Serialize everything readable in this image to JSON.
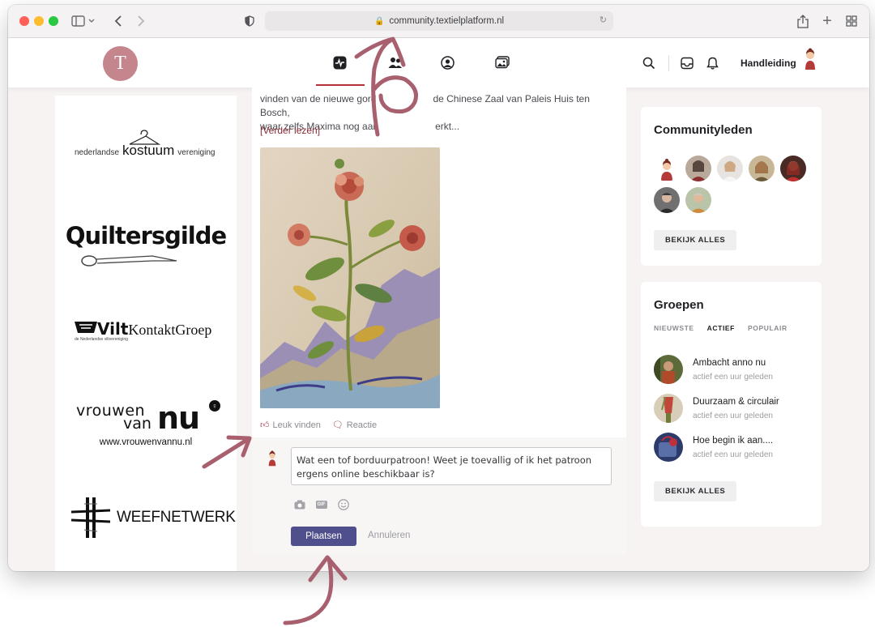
{
  "browser": {
    "url": "community.textielplatform.nl"
  },
  "header": {
    "logo_letter": "T",
    "handleiding_label": "Handleiding",
    "nav_icons": [
      "activity-icon",
      "groups-icon",
      "profile-icon",
      "photos-icon"
    ]
  },
  "sponsors": [
    {
      "name": "nederlandse kostuum vereniging",
      "line1": "nederlandse",
      "line2": "kostuum",
      "line3": "vereniging"
    },
    {
      "name": "Quiltersgilde",
      "text": "Quiltersgilde"
    },
    {
      "name": "Vilt KontaktGroep",
      "text1": "Vilt",
      "text2": "KontaktGroep",
      "sub": "de Nederlandse viltvereniging"
    },
    {
      "name": "vrouwen van nu",
      "text1": "vrouwen",
      "text2": "van",
      "text3": "nu",
      "url": "www.vrouwenvannu.nl"
    },
    {
      "name": "WEEFNETWERK",
      "text": "WEEFNETWERK"
    }
  ],
  "post": {
    "text_line1": "vinden van de nieuwe gord",
    "text_line1b": "de Chinese Zaal van Paleis Huis ten Bosch,",
    "text_line2": "waar zelfs Maxima nog aan",
    "text_line2b": "erkt...",
    "read_more": "[Verder lezen]",
    "like_label": "Leuk vinden",
    "comment_label": "Reactie"
  },
  "comment": {
    "draft": "Wat een tof borduurpatroon! Weet je toevallig of ik het patroon ergens online beschikbaar is?",
    "gif_label": "GIF",
    "post_button": "Plaatsen",
    "cancel_button": "Annuleren"
  },
  "members_card": {
    "title": "Communityleden",
    "view_all": "BEKIJK ALLES"
  },
  "groups_card": {
    "title": "Groepen",
    "tabs": [
      "NIEUWSTE",
      "ACTIEF",
      "POPULAIR"
    ],
    "active_tab": "ACTIEF",
    "groups": [
      {
        "name": "Ambacht anno nu",
        "status": "actief een uur geleden"
      },
      {
        "name": "Duurzaam & circulair",
        "status": "actief een uur geleden"
      },
      {
        "name": "Hoe begin ik aan....",
        "status": "actief een uur geleden"
      }
    ],
    "view_all": "BEKIJK ALLES"
  },
  "colors": {
    "accent": "#b3303a",
    "logo_bg": "#c4868c",
    "primary_button": "#4f4f8d",
    "annotation_arrow": "#a8606f"
  }
}
